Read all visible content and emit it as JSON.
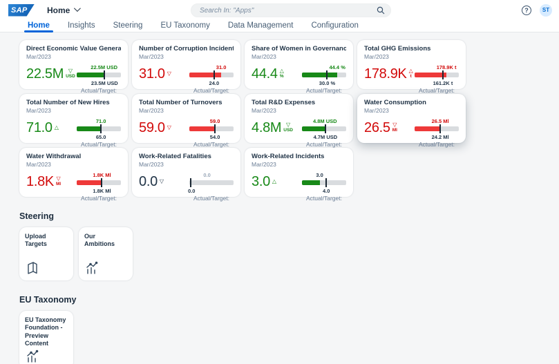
{
  "shell": {
    "logo_text": "SAP",
    "title": "Home",
    "search_placeholder": "Search In: \"Apps\"",
    "avatar_initials": "ST",
    "help_glyph": "?"
  },
  "tabs": [
    {
      "label": "Home",
      "active": true
    },
    {
      "label": "Insights",
      "active": false
    },
    {
      "label": "Steering",
      "active": false
    },
    {
      "label": "EU Taxonomy",
      "active": false
    },
    {
      "label": "Data Management",
      "active": false
    },
    {
      "label": "Configuration",
      "active": false
    }
  ],
  "colors": {
    "good": "#188918",
    "bad": "#d20a0a",
    "bad_bar": "#ee3939",
    "accent": "#0064d9",
    "tick": "#1a2733",
    "track": "#d9dcdf"
  },
  "kpi_tiles": [
    {
      "title": "Direct Economic Value Generated",
      "subtitle": "Mar/2023",
      "value": "22.5M",
      "unit": "USD",
      "trend": "down",
      "state": "good",
      "top_label": "22.5M USD",
      "top_color": "good",
      "bottom_label": "23.5M USD",
      "footer": "Actual/Target:",
      "fill_pct": 62,
      "tick_pct": 63,
      "label_pct": 62,
      "elevated": false
    },
    {
      "title": "Number of Corruption Incidents",
      "subtitle": "Mar/2023",
      "value": "31.0",
      "unit": "",
      "trend": "down",
      "state": "bad",
      "top_label": "31.0",
      "top_color": "bad",
      "bottom_label": "24.0",
      "footer": "Actual/Target:",
      "fill_pct": 72,
      "tick_pct": 56,
      "label_pct": 72,
      "elevated": false
    },
    {
      "title": "Share of Women in Governance Body",
      "subtitle": "Mar/2023",
      "value": "44.4",
      "unit": "%",
      "trend": "up",
      "state": "good",
      "top_label": "44.4 %",
      "top_color": "good",
      "bottom_label": "30.0 %",
      "footer": "Actual/Target:",
      "fill_pct": 80,
      "tick_pct": 57,
      "label_pct": 80,
      "elevated": false
    },
    {
      "title": "Total GHG Emissions",
      "subtitle": "Mar/2023",
      "value": "178.9K",
      "unit": "t",
      "trend": "up",
      "state": "bad",
      "top_label": "178.9K t",
      "top_color": "bad",
      "bottom_label": "161.2K t",
      "footer": "Actual/Target:",
      "fill_pct": 72,
      "tick_pct": 64,
      "label_pct": 72,
      "elevated": false
    },
    {
      "title": "Total Number of New Hires",
      "subtitle": "Mar/2023",
      "value": "71.0",
      "unit": "",
      "trend": "up",
      "state": "good",
      "top_label": "71.0",
      "top_color": "good",
      "bottom_label": "65.0",
      "footer": "Actual/Target:",
      "fill_pct": 54,
      "tick_pct": 55,
      "label_pct": 55,
      "elevated": false
    },
    {
      "title": "Total Number of Turnovers",
      "subtitle": "Mar/2023",
      "value": "59.0",
      "unit": "",
      "trend": "down",
      "state": "bad",
      "top_label": "59.0",
      "top_color": "bad",
      "bottom_label": "54.0",
      "footer": "Actual/Target:",
      "fill_pct": 57,
      "tick_pct": 58,
      "label_pct": 58,
      "elevated": false
    },
    {
      "title": "Total R&D Expenses",
      "subtitle": "Mar/2023",
      "value": "4.8M",
      "unit": "USD",
      "trend": "down",
      "state": "good",
      "top_label": "4.8M USD",
      "top_color": "good",
      "bottom_label": "4.7M USD",
      "footer": "Actual/Target:",
      "fill_pct": 52,
      "tick_pct": 53,
      "label_pct": 52,
      "elevated": false
    },
    {
      "title": "Water Consumption",
      "subtitle": "Mar/2023",
      "value": "26.5",
      "unit": "Ml",
      "trend": "down",
      "state": "bad",
      "top_label": "26.5 Ml",
      "top_color": "bad",
      "bottom_label": "24.2 Ml",
      "footer": "Actual/Target:",
      "fill_pct": 57,
      "tick_pct": 58,
      "label_pct": 58,
      "elevated": true
    },
    {
      "title": "Water Withdrawal",
      "subtitle": "Mar/2023",
      "value": "1.8K",
      "unit": "Ml",
      "trend": "down",
      "state": "bad",
      "top_label": "1.8K Ml",
      "top_color": "bad",
      "bottom_label": "1.8K Ml",
      "footer": "Actual/Target:",
      "fill_pct": 56,
      "tick_pct": 57,
      "label_pct": 57,
      "elevated": false
    },
    {
      "title": "Work-Related Fatalities",
      "subtitle": "Mar/2023",
      "value": "0.0",
      "unit": "",
      "trend": "down",
      "state": "neutral",
      "top_label": "0.0",
      "top_color": "muted",
      "bottom_label": "0.0",
      "footer": "Actual/Target:",
      "fill_pct": 0,
      "tick_pct": 3,
      "label_pct": 40,
      "elevated": false
    },
    {
      "title": "Work-Related Incidents",
      "subtitle": "Mar/2023",
      "value": "3.0",
      "unit": "",
      "trend": "up",
      "state": "good",
      "top_label": "3.0",
      "top_color": "dark",
      "bottom_label": "4.0",
      "footer": "Actual/Target:",
      "fill_pct": 40,
      "tick_pct": 55,
      "label_pct": 40,
      "elevated": false
    }
  ],
  "steering": {
    "title": "Steering",
    "tiles": [
      {
        "label": "Upload Targets",
        "icon": "documents-icon"
      },
      {
        "label": "Our Ambitions",
        "icon": "chart-growth-icon"
      }
    ]
  },
  "eu_taxonomy": {
    "title": "EU Taxonomy",
    "tiles": [
      {
        "label": "EU Taxonomy Foundation - Preview Content",
        "icon": "chart-growth-icon"
      }
    ]
  }
}
